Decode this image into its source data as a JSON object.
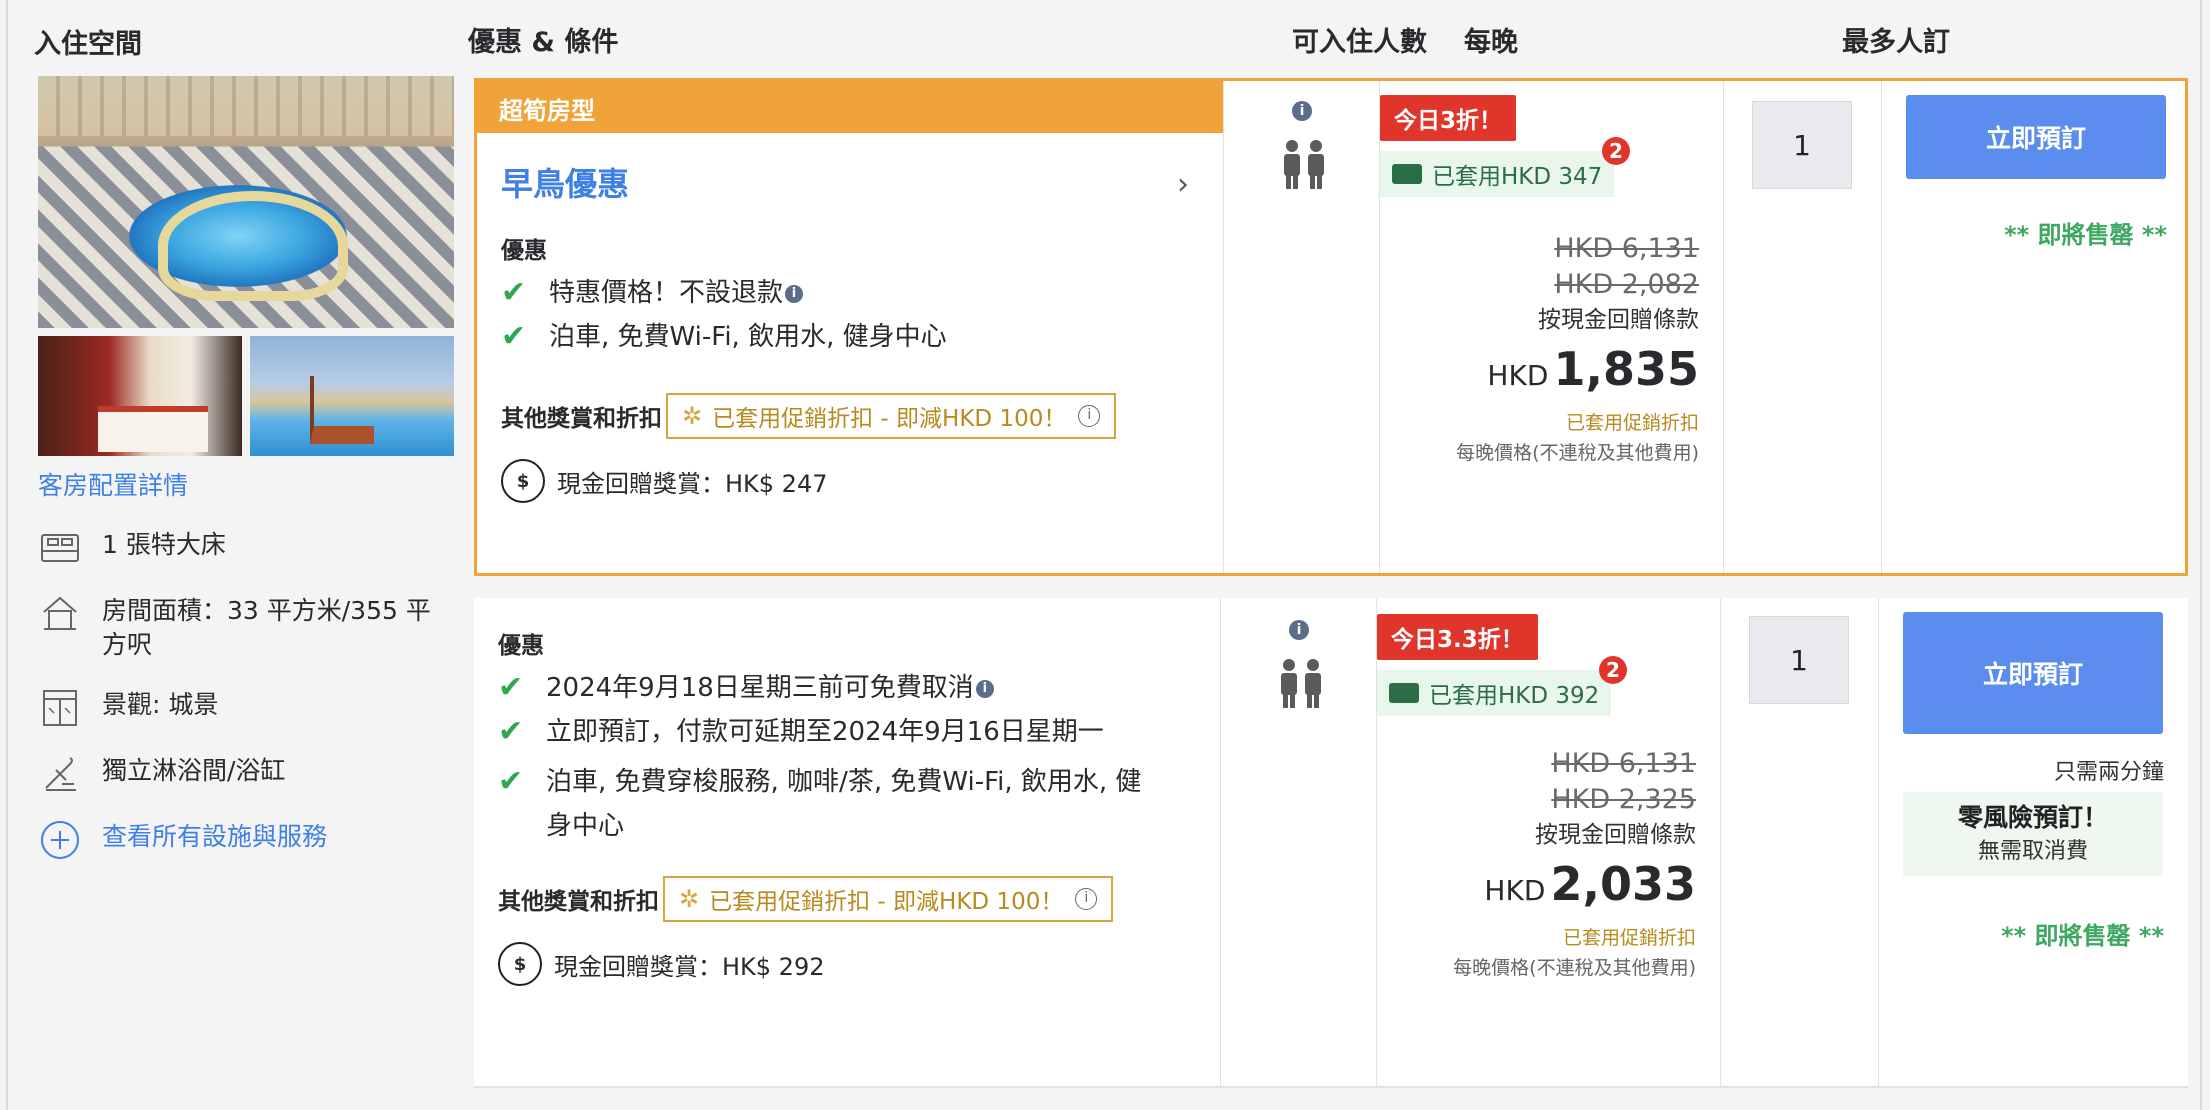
{
  "headers": {
    "room": "入住空間",
    "offers": "優惠 & 條件",
    "occupancy": "可入住人數",
    "per_night": "每晚",
    "max_rooms": "最多人訂"
  },
  "room": {
    "details_link": "客房配置詳情",
    "features": [
      {
        "icon": "bed-icon",
        "text": "1 張特大床"
      },
      {
        "icon": "house-icon",
        "text": "房間面積：33 平方米/355 平方呎"
      },
      {
        "icon": "window-icon",
        "text": "景觀: 城景"
      },
      {
        "icon": "shower-icon",
        "text": "獨立淋浴間/浴缸"
      }
    ],
    "all_facilities": "查看所有設施與服務"
  },
  "offers": [
    {
      "banner": "超筍房型",
      "deal_name": "早鳥優惠",
      "section_title": "優惠",
      "benefits": [
        "特惠價格！不設退款",
        "泊車, 免費Wi-Fi, 飲用水, 健身中心"
      ],
      "other_title": "其他獎賞和折扣",
      "promo_text": "已套用促銷折扣 - 即減HKD 100！",
      "cashback": "現金回贈獎賞：HK$ 247",
      "discount_tag": "今日3折！",
      "applied_tag": "已套用HKD 347",
      "badge": "2",
      "original_price": "HKD 6,131",
      "strike_price": "HKD 2,082",
      "cashback_terms": "按現金回贈條款",
      "currency": "HKD",
      "final_price": "1,835",
      "promo_applied": "已套用促銷折扣",
      "per_night_note": "每晚價格(不連稅及其他費用)",
      "quantity": "1",
      "book_label": "立即預訂",
      "selling_fast": "** 即將售罄 **"
    },
    {
      "section_title": "優惠",
      "benefits": [
        "2024年9月18日星期三前可免費取消",
        "立即預訂，付款可延期至2024年9月16日星期一",
        "泊車, 免費穿梭服務, 咖啡/茶, 免費Wi-Fi, 飲用水, 健身中心"
      ],
      "other_title": "其他獎賞和折扣",
      "promo_text": "已套用促銷折扣 - 即減HKD 100！",
      "cashback": "現金回贈獎賞：HK$ 292",
      "discount_tag": "今日3.3折！",
      "applied_tag": "已套用HKD 392",
      "badge": "2",
      "original_price": "HKD 6,131",
      "strike_price": "HKD 2,325",
      "cashback_terms": "按現金回贈條款",
      "currency": "HKD",
      "final_price": "2,033",
      "promo_applied": "已套用促銷折扣",
      "per_night_note": "每晚價格(不連稅及其他費用)",
      "quantity": "1",
      "book_label": "立即預訂",
      "only_two_min": "只需兩分鐘",
      "no_risk_title": "零風險預訂！",
      "no_risk_sub": "無需取消費",
      "selling_fast": "** 即將售罄 **"
    }
  ],
  "colors": {
    "accent_orange": "#f0a339",
    "link_blue": "#3e80e6",
    "book_blue": "#5b8def",
    "discount_red": "#e0352b",
    "sell_green": "#3ea862"
  }
}
